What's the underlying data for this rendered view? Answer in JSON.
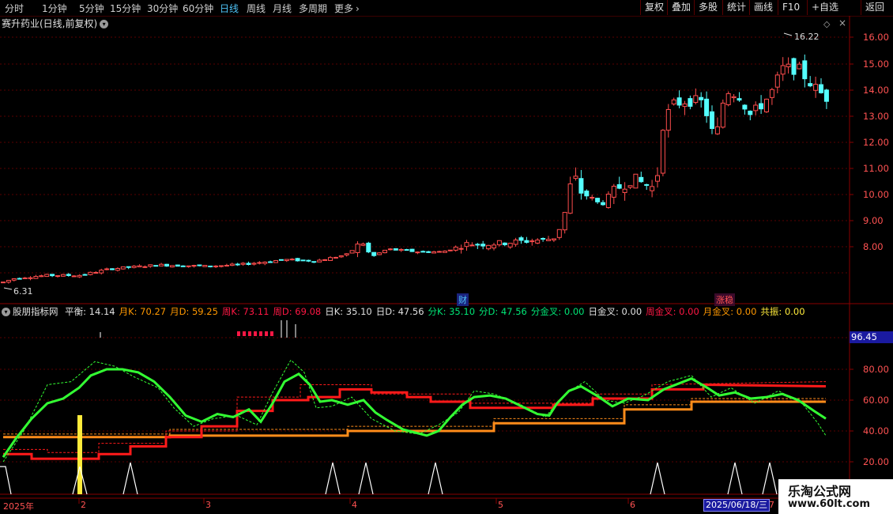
{
  "toolbar": {
    "periods": [
      "分时",
      "1分钟",
      "5分钟",
      "15分钟",
      "30分钟",
      "60分钟",
      "日线",
      "周线",
      "月线",
      "多周期",
      "更多"
    ],
    "active": "日线",
    "right_buttons": [
      "复权",
      "叠加",
      "多股",
      "统计",
      "画线",
      "F10",
      "+自选",
      "返回"
    ]
  },
  "title": "赛升药业(日线,前复权)",
  "price_axis": [
    "16.00",
    "15.00",
    "14.00",
    "13.00",
    "12.00",
    "11.00",
    "10.00",
    "9.00",
    "8.00"
  ],
  "high_marker": "16.22",
  "low_marker": "6.31",
  "event_tags": [
    "财",
    "涨稳"
  ],
  "indicator": {
    "name": "股朋指标网",
    "values": [
      {
        "label": "平衡",
        "value": "14.14",
        "color": "#e0e0e0"
      },
      {
        "label": "月K",
        "value": "70.27",
        "color": "#ff9800"
      },
      {
        "label": "月D",
        "value": "59.25",
        "color": "#ff9800"
      },
      {
        "label": "周K",
        "value": "73.11",
        "color": "#ff1744"
      },
      {
        "label": "周D",
        "value": "69.08",
        "color": "#ff1744"
      },
      {
        "label": "日K",
        "value": "35.10",
        "color": "#e0e0e0"
      },
      {
        "label": "日D",
        "value": "47.56",
        "color": "#e0e0e0"
      },
      {
        "label": "分K",
        "value": "35.10",
        "color": "#00e676"
      },
      {
        "label": "分D",
        "value": "47.56",
        "color": "#00e676"
      },
      {
        "label": "分金叉",
        "value": "0.00",
        "color": "#00e676"
      },
      {
        "label": "日金叉",
        "value": "0.00",
        "color": "#e0e0e0"
      },
      {
        "label": "周金叉",
        "value": "0.00",
        "color": "#ff1744"
      },
      {
        "label": "月金叉",
        "value": "0.00",
        "color": "#ff9800"
      },
      {
        "label": "共振",
        "value": "0.00",
        "color": "#ffeb3b"
      }
    ],
    "cursor_value": "96.45",
    "axis": [
      "80.00",
      "60.00",
      "40.00",
      "20.00"
    ]
  },
  "date_axis": {
    "labels": [
      "2025年",
      "2",
      "3",
      "4",
      "5",
      "6"
    ],
    "cursor_date": "2025/06/18/三",
    "tail": "7"
  },
  "watermark": {
    "name": "乐淘公式网",
    "url": "www.60lt.com"
  }
}
